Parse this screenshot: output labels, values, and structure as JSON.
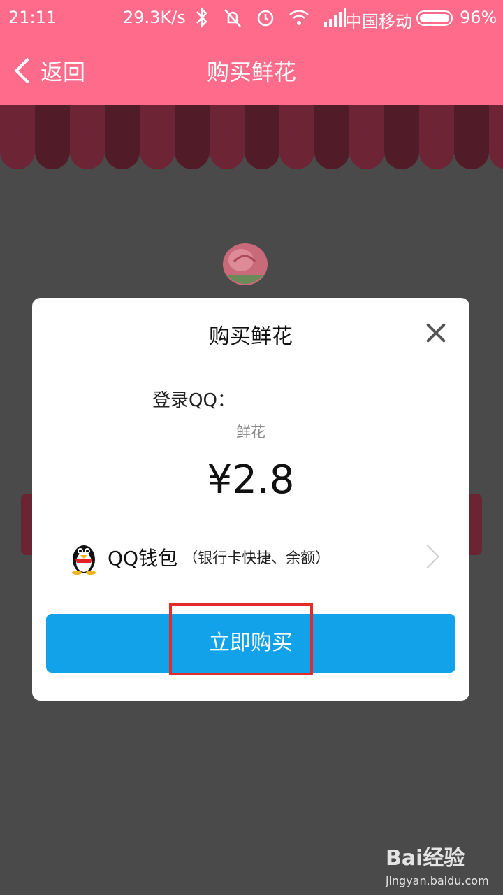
{
  "status_bar": {
    "time": "21:11",
    "speed": "29.3K/s",
    "carrier": "中国移动",
    "battery": "96%",
    "icons": [
      "bluetooth-icon",
      "mute-icon",
      "alarm-icon",
      "wifi-icon",
      "signal-icon",
      "battery-icon"
    ]
  },
  "nav": {
    "back_label": "返回",
    "title": "购买鲜花"
  },
  "dialog": {
    "title": "购买鲜花",
    "login_label": "登录QQ：",
    "item_name": "鲜花",
    "price": "¥2.8",
    "payment": {
      "method": "QQ钱包",
      "note": "（银行卡快捷、余额）"
    },
    "buy_button": "立即购买"
  },
  "watermark": {
    "brand": "Bai经验",
    "url": "jingyan.baidu.com"
  },
  "colors": {
    "header": "#ff6c8b",
    "buy_button": "#12a2ea",
    "highlight": "#e52a2a"
  }
}
